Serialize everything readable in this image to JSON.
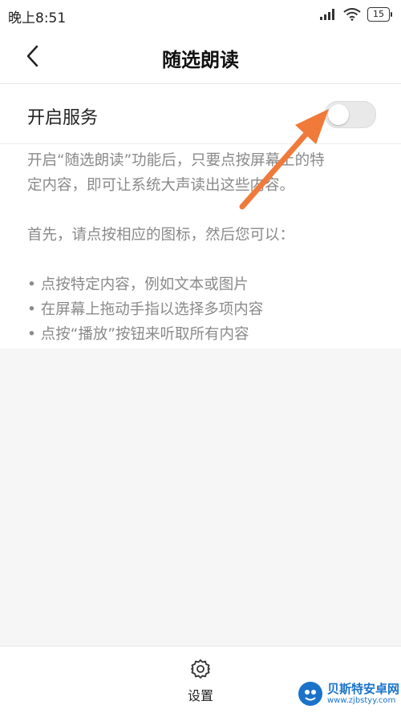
{
  "status_bar": {
    "time": "晚上8:51",
    "battery": "15"
  },
  "header": {
    "title": "随选朗读"
  },
  "service_toggle": {
    "label": "开启服务",
    "enabled": false
  },
  "description": {
    "lines": [
      "开启“随选朗读”功能后，只要点按屏幕上的特",
      "定内容，即可让系统大声读出这些内容。",
      "",
      "首先，请点按相应的图标，然后您可以：",
      "",
      "• 点按特定内容，例如文本或图片",
      "• 在屏幕上拖动手指以选择多项内容",
      "• 点按“播放”按钮来听取所有内容"
    ]
  },
  "bottom_nav": {
    "settings_label": "设置"
  },
  "watermark": {
    "main": "贝斯特安卓网",
    "url": "www.zjbstyy.com"
  },
  "colors": {
    "arrow": "#f07a3a",
    "toggle_off": "#e9e9e9",
    "watermark": "#1a73c9"
  }
}
